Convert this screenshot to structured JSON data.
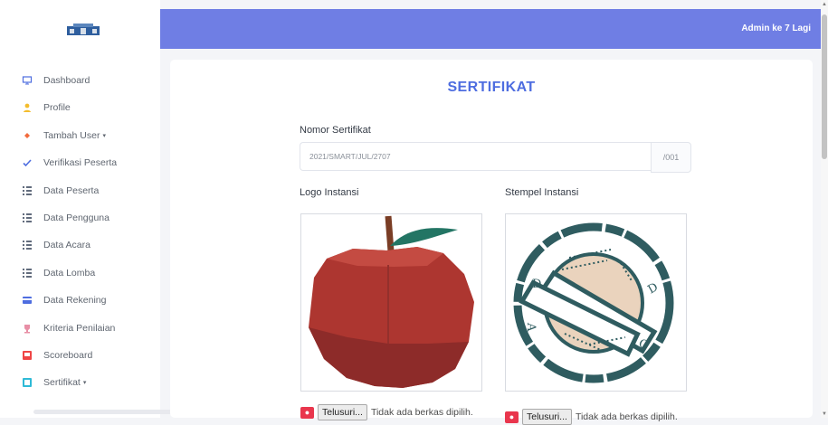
{
  "sidebar": {
    "items": [
      {
        "label": "Dashboard",
        "icon": "monitor-icon"
      },
      {
        "label": "Profile",
        "icon": "user-icon"
      },
      {
        "label": "Tambah User",
        "icon": "diamond-icon",
        "caret": "▾"
      },
      {
        "label": "Verifikasi Peserta",
        "icon": "check-icon"
      },
      {
        "label": "Data Peserta",
        "icon": "list-icon"
      },
      {
        "label": "Data Pengguna",
        "icon": "list-icon"
      },
      {
        "label": "Data Acara",
        "icon": "list-icon"
      },
      {
        "label": "Data Lomba",
        "icon": "list-icon"
      },
      {
        "label": "Data Rekening",
        "icon": "credit-card-icon"
      },
      {
        "label": "Kriteria Penilaian",
        "icon": "trophy-icon"
      },
      {
        "label": "Scoreboard",
        "icon": "scoreboard-icon"
      },
      {
        "label": "Sertifikat",
        "icon": "certificate-icon",
        "caret": "▾"
      }
    ]
  },
  "header": {
    "user": "Admin ke 7 Lagi"
  },
  "main": {
    "title": "SERTIFIKAT",
    "certificate_number": {
      "label": "Nomor Sertifikat",
      "value": "2021/SMART/JUL/2707",
      "suffix": "/001"
    },
    "logo": {
      "label": "Logo Instansi",
      "file_button": "Telusuri...",
      "file_status": "Tidak ada berkas dipilih."
    },
    "stamp": {
      "label": "Stempel Instansi",
      "file_button": "Telusuri...",
      "file_status": "Tidak ada berkas dipilih.",
      "letters": [
        "D",
        "D",
        "A",
        "O"
      ]
    }
  },
  "colors": {
    "topbar": "#6f7ee4",
    "title": "#4e6de0",
    "apple_red": "#ad3630",
    "stamp_outline": "#2f5c60",
    "stamp_fill": "#ead3bd"
  }
}
